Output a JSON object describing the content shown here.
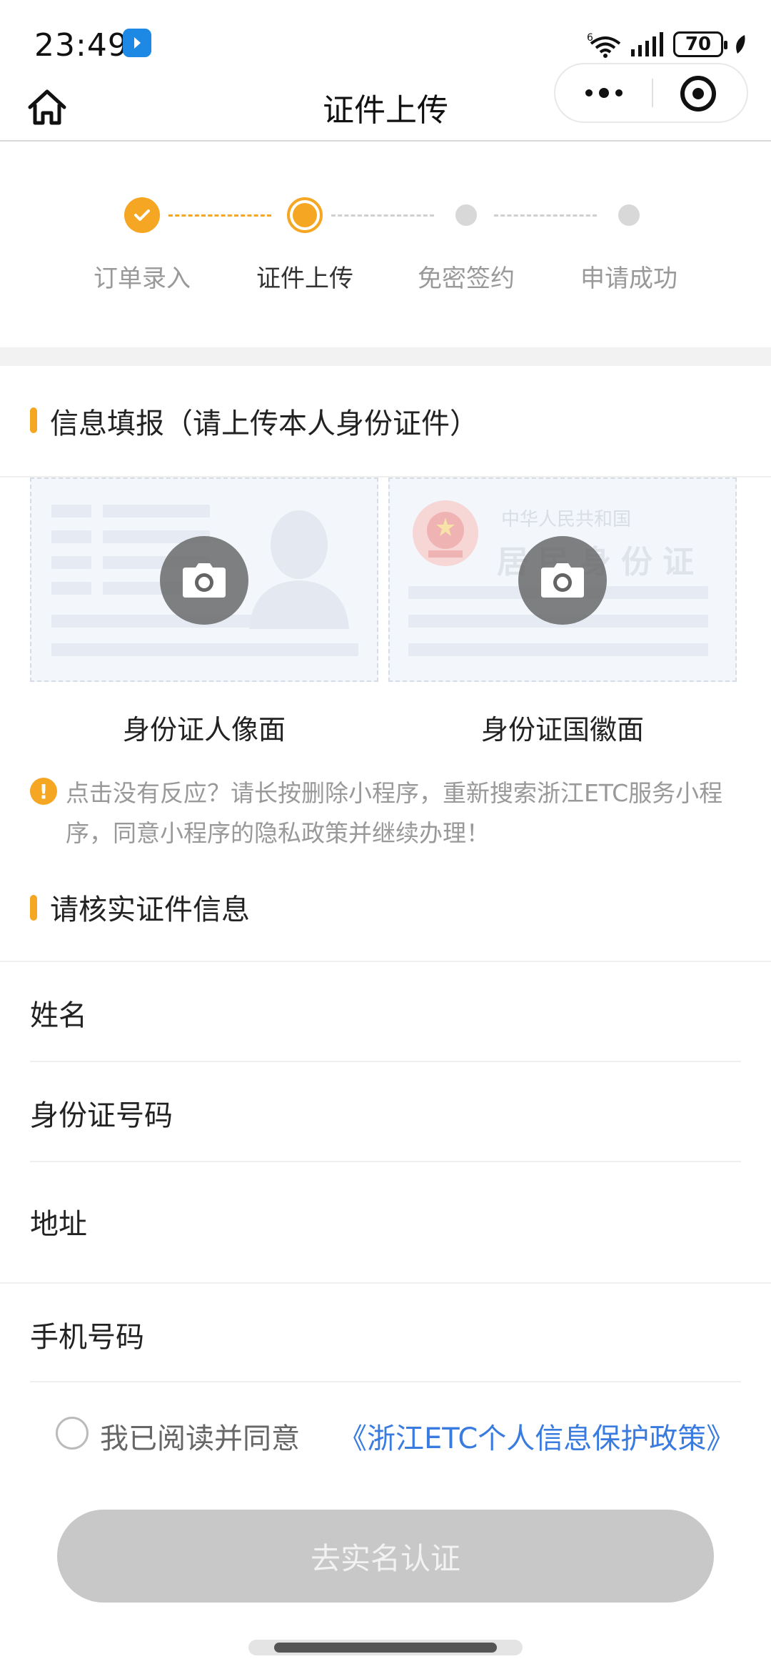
{
  "status_bar": {
    "time": "23:49",
    "network": "6",
    "battery": "70"
  },
  "nav": {
    "title": "证件上传"
  },
  "steps": [
    {
      "label": "订单录入",
      "state": "done"
    },
    {
      "label": "证件上传",
      "state": "current"
    },
    {
      "label": "免密签约",
      "state": "pending"
    },
    {
      "label": "申请成功",
      "state": "pending"
    }
  ],
  "upload_section": {
    "title": "信息填报（请上传本人身份证件）",
    "front_label": "身份证人像面",
    "back_label": "身份证国徽面",
    "back_card_header": "中华人民共和国",
    "back_card_title": "居民身份证"
  },
  "tip": {
    "text": "点击没有反应？请长按删除小程序，重新搜索浙江ETC服务小程序，同意小程序的隐私政策并继续办理！"
  },
  "verify_section": {
    "title": "请核实证件信息",
    "fields": [
      {
        "label": "姓名"
      },
      {
        "label": "身份证号码"
      },
      {
        "label": "地址"
      },
      {
        "label": "手机号码"
      }
    ]
  },
  "consent": {
    "text": "我已阅读并同意",
    "link": "《浙江ETC个人信息保护政策》"
  },
  "submit_button": {
    "label": "去实名认证"
  },
  "colors": {
    "accent": "#f5a623",
    "link": "#3a7be0",
    "disabled_button": "#c8c8c8"
  }
}
